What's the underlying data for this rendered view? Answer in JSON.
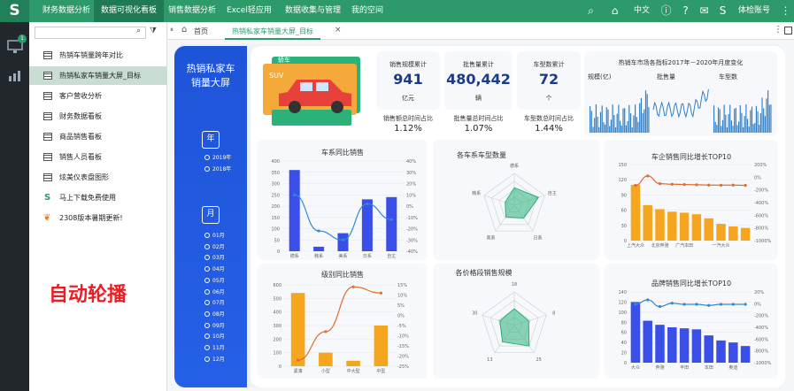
{
  "app": {
    "logo": "S"
  },
  "nav": [
    "财务数据分析",
    "数据可视化看板",
    "销售数据分析",
    "Excel轻应用",
    "数据收集与管理",
    "我的空间"
  ],
  "topright": {
    "lang": "中文",
    "account": "体检账号"
  },
  "left": {
    "badge": "1"
  },
  "tree": [
    {
      "label": "热销车销量跨年对比",
      "icon": "table-icon"
    },
    {
      "label": "热销私家车销量大屏_目标",
      "icon": "table-icon",
      "selected": true
    },
    {
      "label": "客户营收分析",
      "icon": "table-icon"
    },
    {
      "label": "财务数据看板",
      "icon": "table-icon"
    },
    {
      "label": "商品销售看板",
      "icon": "table-icon"
    },
    {
      "label": "销售人员看板",
      "icon": "table-icon"
    },
    {
      "label": "炫美仪表盘图形",
      "icon": "table-icon"
    },
    {
      "label": "马上下载免费使用",
      "icon": "s-logo-icon"
    },
    {
      "label": "2308版本暑期更新!",
      "icon": "leaf-icon"
    }
  ],
  "watermark": "自动轮播",
  "tabs": {
    "home": "首页",
    "active": "热销私家车销量大屏_目标",
    "close": "×"
  },
  "dashboard": {
    "title_l1": "热销私家车",
    "title_l2": "销量大屏",
    "year_label": "年",
    "month_label": "月",
    "years": [
      "2019年",
      "2018年"
    ],
    "months": [
      "01月",
      "02月",
      "03月",
      "04月",
      "05月",
      "06月",
      "07月",
      "08月",
      "09月",
      "10月",
      "11月",
      "12月"
    ],
    "car_tag": "轿车",
    "car_suv": "SUV",
    "kpis": [
      {
        "title": "销售规模累计",
        "value": "941",
        "unit": "亿元",
        "sub": "销售额总时间占比",
        "pct": "1.12%"
      },
      {
        "title": "批售量累计",
        "value": "480,442",
        "unit": "辆",
        "sub": "批售量总时间占比",
        "pct": "1.07%"
      },
      {
        "title": "车型数累计",
        "value": "72",
        "unit": "个",
        "sub": "车型数总时间占比",
        "pct": "1.44%"
      }
    ],
    "market": {
      "title": "热销车市场各指标2017年－2020年月度变化",
      "labels": [
        "规模(亿)",
        "批售量",
        "车型数"
      ]
    },
    "charts_titles": [
      "车系同比销售",
      "各车系车型数量",
      "车企销售同比增长TOP10",
      "级别同比销售",
      "各价格段销售规模",
      "品牌销售同比增长TOP10"
    ]
  },
  "chart_data": [
    {
      "type": "bar",
      "title": "车系同比销售",
      "categories": [
        "德系",
        "韩系",
        "美系",
        "日系",
        "自主"
      ],
      "values": [
        360,
        20,
        80,
        230,
        240
      ],
      "line": [
        10,
        -22,
        -30,
        2,
        -12
      ],
      "ylim": [
        0,
        400
      ],
      "y2lim": [
        -40,
        40
      ],
      "yticks": [
        "0",
        "50",
        "100",
        "150",
        "200",
        "250",
        "300",
        "350",
        "400"
      ],
      "y2ticks": [
        "40%",
        "30%",
        "20%",
        "10%",
        "0%",
        "-10%",
        "-20%",
        "-30%",
        "-40%"
      ]
    },
    {
      "type": "radar",
      "title": "各车系车型数量",
      "axes": [
        "德系",
        "自主",
        "日系",
        "美系",
        "韩系"
      ],
      "values": [
        0.55,
        0.8,
        0.5,
        0.45,
        0.3
      ]
    },
    {
      "type": "bar",
      "title": "车企销售同比增长TOP10",
      "categories": [
        "上汽大众",
        "",
        "北京奔驰",
        "",
        "广汽本田",
        "",
        "",
        "一汽大众",
        "",
        ""
      ],
      "values": [
        110,
        70,
        62,
        57,
        55,
        52,
        44,
        33,
        28,
        25
      ],
      "line": [
        0,
        170,
        30,
        20,
        15,
        10,
        5,
        3,
        5,
        0
      ],
      "ylim": [
        0,
        150
      ],
      "yticks": [
        "0",
        "30",
        "60",
        "90",
        "120",
        "150"
      ],
      "y2ticks": [
        "200%",
        "0%",
        "-200%",
        "-400%",
        "-600%",
        "-800%",
        "-1000%"
      ]
    },
    {
      "type": "bar",
      "title": "级别同比销售",
      "categories": [
        "紧凑",
        "小型",
        "中大型",
        "中型"
      ],
      "values": [
        540,
        100,
        40,
        300
      ],
      "line": [
        -22,
        -8,
        14,
        11
      ],
      "ylim": [
        0,
        600
      ],
      "yticks": [
        "0",
        "100",
        "200",
        "300",
        "400",
        "500",
        "600"
      ],
      "y2ticks": [
        "15%",
        "10%",
        "5%",
        "0%",
        "-5%",
        "-10%",
        "-15%",
        "-20%",
        "-25%"
      ]
    },
    {
      "type": "radar",
      "title": "各价格段销售规模",
      "axes": [
        "18",
        "8",
        "25",
        "13",
        "30"
      ],
      "values": [
        0.5,
        0.45,
        0.75,
        0.6,
        0.45
      ]
    },
    {
      "type": "bar",
      "title": "品牌销售同比增长TOP10",
      "categories": [
        "大众",
        "",
        "奔驰",
        "",
        "丰田",
        "",
        "本田",
        "",
        "奥迪",
        ""
      ],
      "values": [
        120,
        83,
        75,
        70,
        68,
        66,
        54,
        44,
        40,
        33
      ],
      "line": [
        0,
        20,
        -10,
        5,
        0,
        0,
        -5,
        0,
        0,
        0
      ],
      "ylim": [
        0,
        140
      ],
      "yticks": [
        "0",
        "20",
        "40",
        "60",
        "80",
        "100",
        "120",
        "140"
      ],
      "y2ticks": [
        "20%",
        "0%",
        "-200%",
        "-400%",
        "-600%",
        "-800%",
        "-1000%"
      ]
    }
  ]
}
